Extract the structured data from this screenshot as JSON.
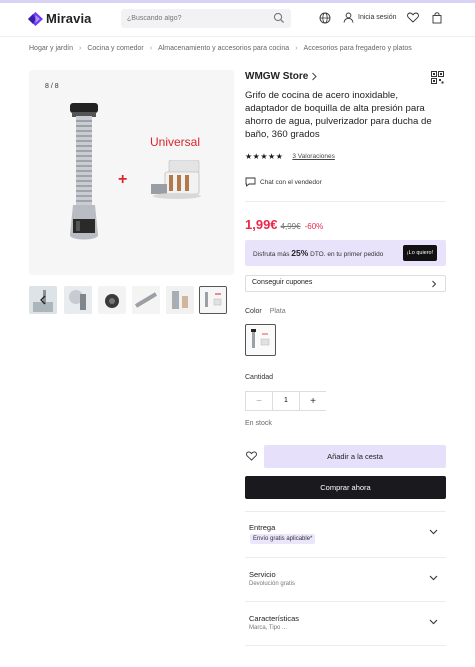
{
  "header": {
    "logo_text": "Miravia",
    "search_placeholder": "¿Buscando algo?",
    "signin_label": "Inicia sesión"
  },
  "breadcrumb": [
    "Hogar y jardín",
    "Cocina y comedor",
    "Almacenamiento y accesorios para cocina",
    "Accesorios para fregadero y platos"
  ],
  "gallery": {
    "counter": "8 / 8",
    "overlay_text": "Universal",
    "plus": "+",
    "thumbnails": 6,
    "selected_index": 5
  },
  "product": {
    "store": "WMGW Store",
    "title": "Grifo de cocina de acero inoxidable, adaptador de boquilla de alta presión para ahorro de agua, pulverizador para ducha de baño, 360 grados",
    "stars": "★★★★★",
    "rating": 5,
    "reviews": "3 Valoraciones",
    "chat": "Chat con el vendedor",
    "price": "1,99€",
    "original_price": "4,99€",
    "discount": "-60%"
  },
  "promo": {
    "prefix": "Disfruta más",
    "pct": "25%",
    "suffix": "DTO. en tu primer pedido",
    "button": "¡Lo quiero!"
  },
  "coupons_label": "Conseguir cupones",
  "color": {
    "label": "Color",
    "value": "Plata"
  },
  "quantity": {
    "label": "Cantidad",
    "minus": "−",
    "value": "1",
    "plus": "+"
  },
  "stock": "En stock",
  "actions": {
    "add_to_cart": "Añadir a la cesta",
    "buy_now": "Comprar ahora"
  },
  "accordions": [
    {
      "title": "Entrega",
      "subtitle": "Envío gratis aplicable*"
    },
    {
      "title": "Servicio",
      "subtitle": "Devolución gratis"
    },
    {
      "title": "Características",
      "subtitle": "Marca, Tipo ..."
    }
  ],
  "colors": {
    "accent": "#e8284c",
    "lavender": "#e6e0fa",
    "dark": "#1a1a1e"
  }
}
